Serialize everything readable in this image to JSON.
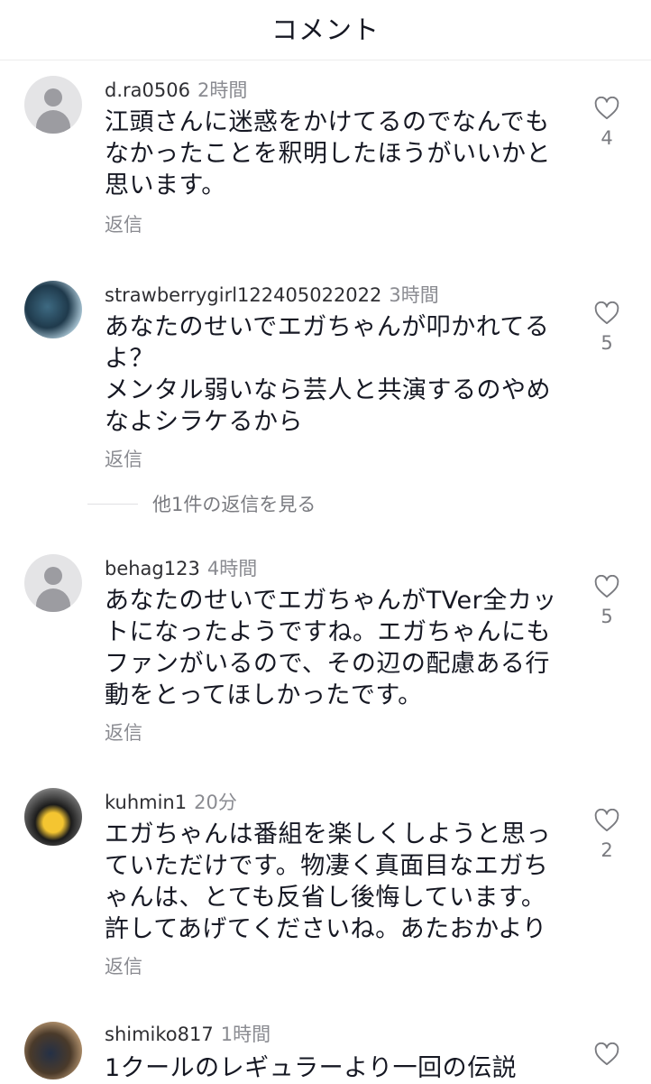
{
  "header": {
    "title": "コメント"
  },
  "comments": [
    {
      "username": "d.ra0506",
      "time": "2時間",
      "text": "江頭さんに迷惑をかけてるのでなんでも\nなかったことを釈明したほうがいいかと\n思います。",
      "reply_label": "返信",
      "likes": "4"
    },
    {
      "username": "strawberrygirl122405022022",
      "time": "3時間",
      "text": "あなたのせいでエガちゃんが叩かれてる\nよ？\nメンタル弱いなら芸人と共演するのやめ\nなよシラケるから",
      "reply_label": "返信",
      "likes": "5"
    },
    {
      "username": "behag123",
      "time": "4時間",
      "text": "あなたのせいでエガちゃんがTVer全カッ\nトになったようですね。エガちゃんにも\nファンがいるので、その辺の配慮ある行\n動をとってほしかったです。",
      "reply_label": "返信",
      "likes": "5"
    },
    {
      "username": "kuhmin1",
      "time": "20分",
      "text": "エガちゃんは番組を楽しくしようと思っ\nていただけです。物凄く真面目なエガち\nゃんは、とても反省し後悔しています。\n許してあげてくださいね。あたおかより",
      "reply_label": "返信",
      "likes": "2"
    },
    {
      "username": "shimiko817",
      "time": "1時間",
      "text": "1クールのレギュラーより一回の伝説"
    }
  ],
  "more_replies": {
    "label": "他1件の返信を見る"
  },
  "icons": {
    "like": "heart-outline-icon",
    "avatar_default": "user-silhouette-icon"
  }
}
